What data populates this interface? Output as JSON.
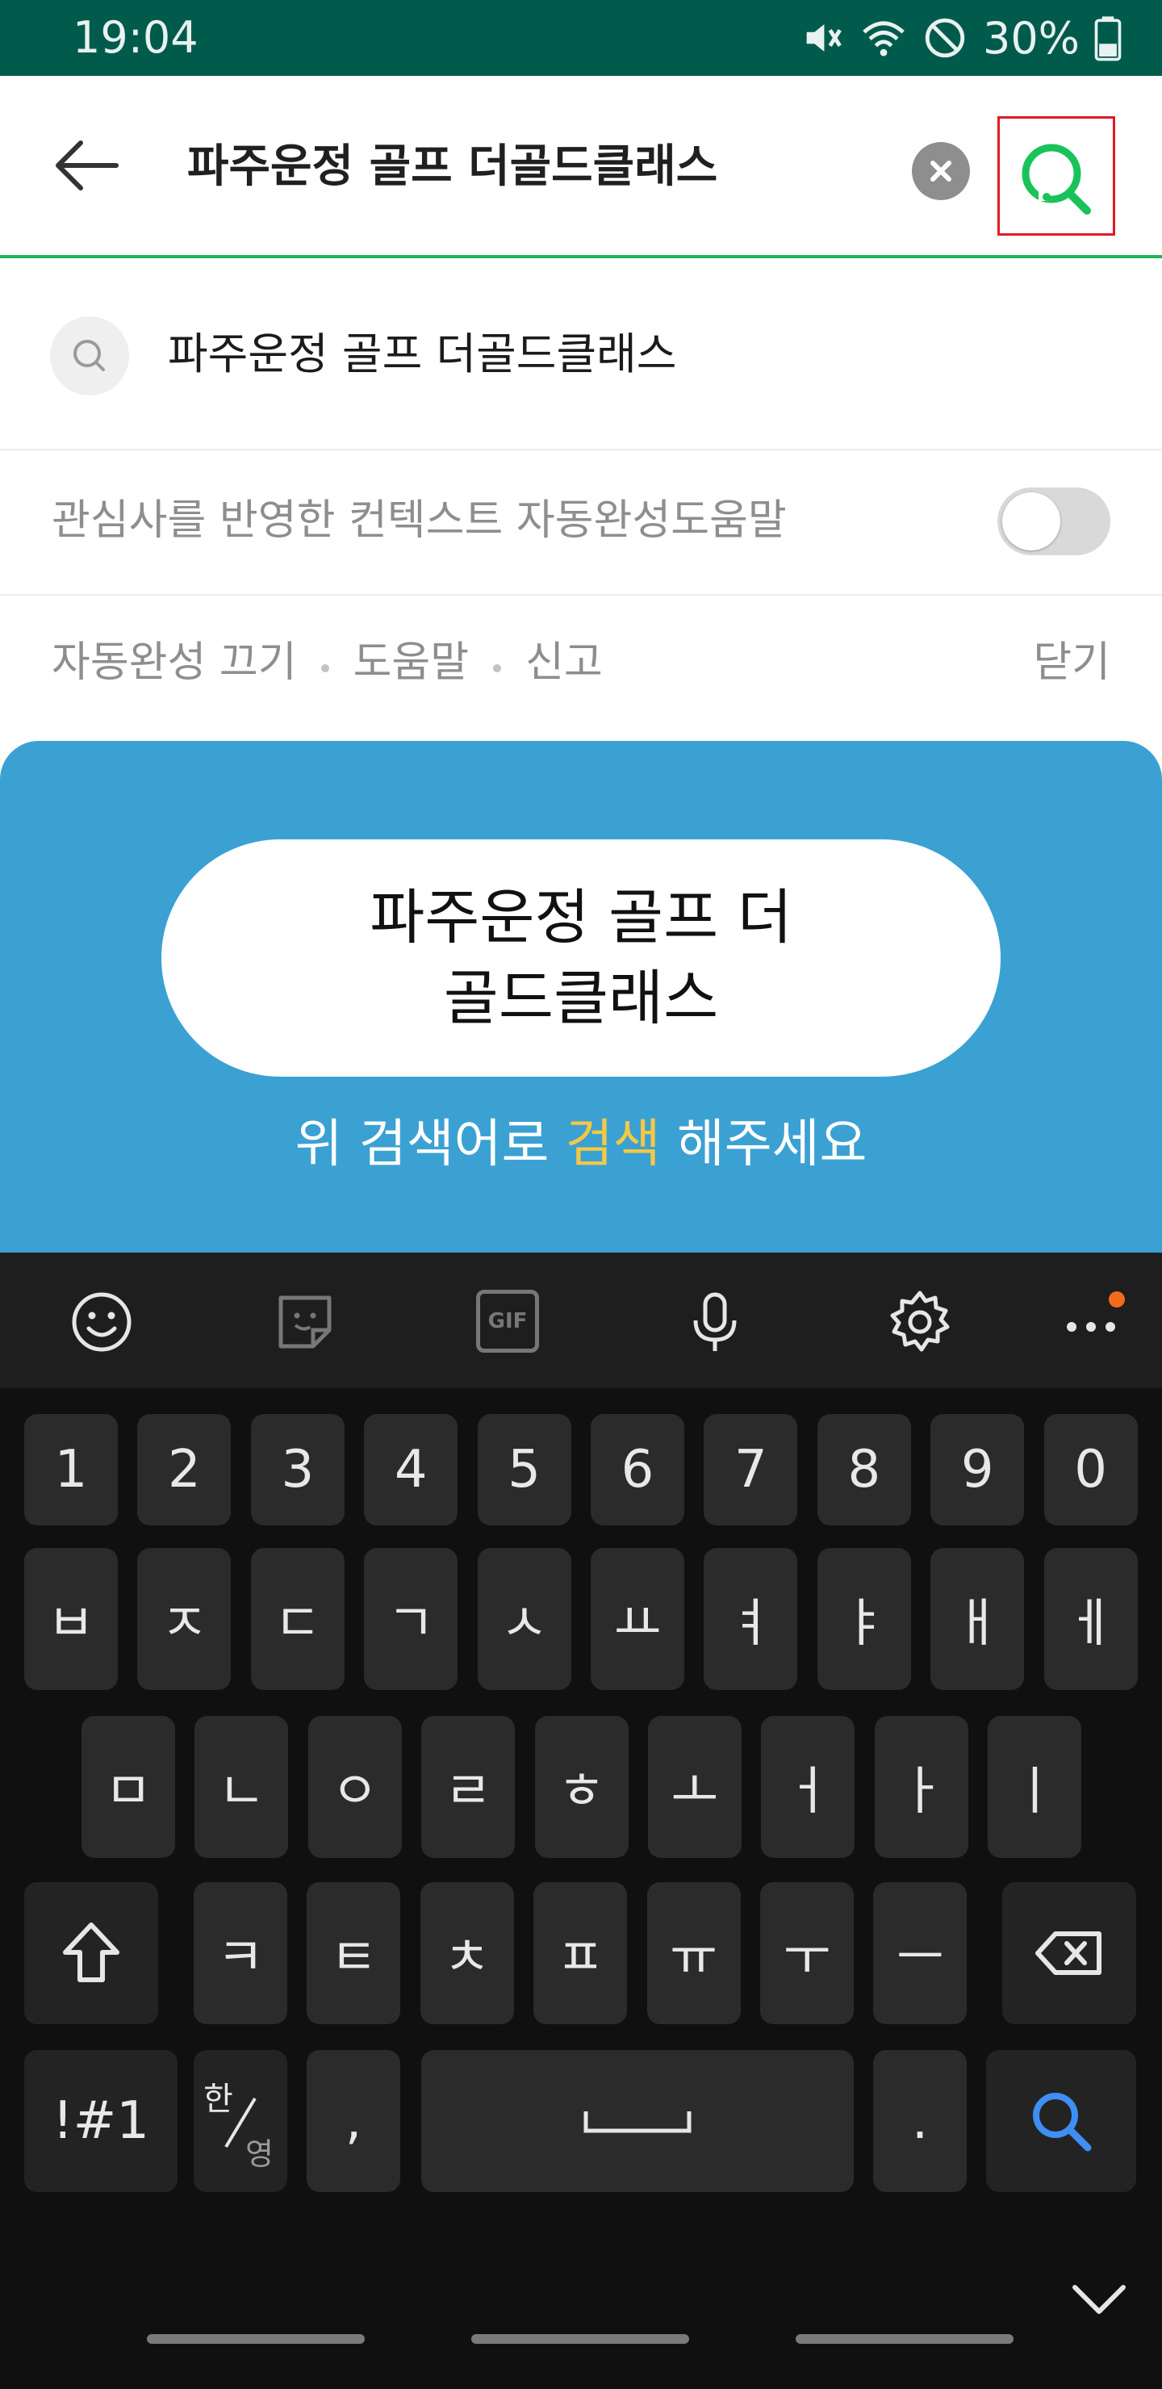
{
  "status_bar": {
    "time": "19:04",
    "battery": "30%",
    "icons": [
      "mute-icon",
      "wifi-icon",
      "do-not-disturb-icon",
      "battery-icon"
    ]
  },
  "search": {
    "query": "파주운정 골프 더골드클래스",
    "accent_color": "#1fb45a"
  },
  "suggestion": {
    "text": "파주운정 골프 더골드클래스"
  },
  "context_toggle": {
    "label": "관심사를 반영한 컨텍스트 자동완성도움말",
    "state": "off"
  },
  "options": {
    "autocomplete_off": "자동완성 끄기",
    "help": "도움말",
    "report": "신고",
    "close": "닫기"
  },
  "promo": {
    "pill_text": "파주운정 골프 더골드클래스",
    "caption_before": "위 검색어로",
    "caption_highlight": "검색",
    "caption_after": "해주세요",
    "background": "#3ba1d3",
    "highlight_color": "#f5c842"
  },
  "keyboard": {
    "toolbar": [
      "emoji-icon",
      "sticker-icon",
      "gif-icon",
      "microphone-icon",
      "settings-icon",
      "more-icon"
    ],
    "gif_label": "GIF",
    "row1": [
      "1",
      "2",
      "3",
      "4",
      "5",
      "6",
      "7",
      "8",
      "9",
      "0"
    ],
    "row2": [
      "ㅂ",
      "ㅈ",
      "ㄷ",
      "ㄱ",
      "ㅅ",
      "ㅛ",
      "ㅕ",
      "ㅑ",
      "ㅐ",
      "ㅔ"
    ],
    "row3": [
      "ㅁ",
      "ㄴ",
      "ㅇ",
      "ㄹ",
      "ㅎ",
      "ㅗ",
      "ㅓ",
      "ㅏ",
      "ㅣ"
    ],
    "row4": [
      "ㅋ",
      "ㅌ",
      "ㅊ",
      "ㅍ",
      "ㅠ",
      "ㅜ",
      "ㅡ"
    ],
    "symbols_label": "!#1",
    "lang_top": "한",
    "lang_bottom": "영",
    "comma": ",",
    "period": "."
  }
}
